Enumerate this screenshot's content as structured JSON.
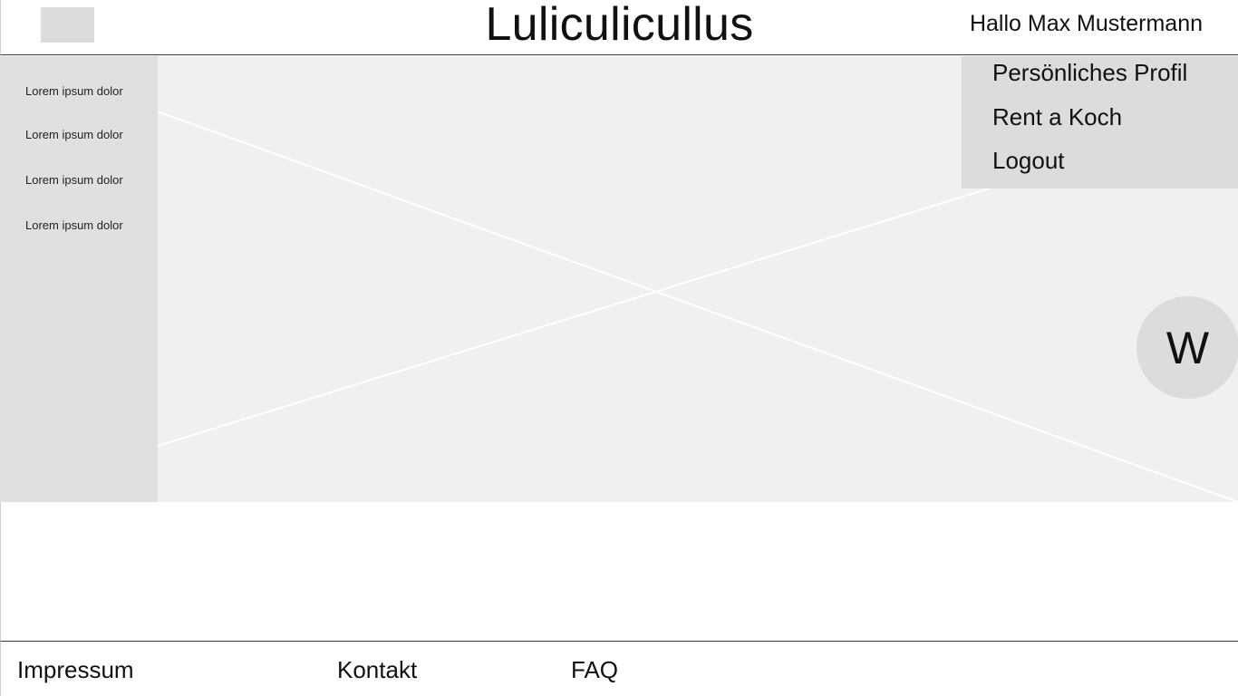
{
  "header": {
    "title": "Luliculicullus",
    "greeting": "Hallo Max Mustermann",
    "logo_icon": "logo-placeholder"
  },
  "sidebar": {
    "items": [
      {
        "label": "Lorem ipsum dolor"
      },
      {
        "label": "Lorem ipsum dolor"
      },
      {
        "label": "Lorem ipsum dolor"
      },
      {
        "label": "Lorem ipsum dolor"
      }
    ]
  },
  "hero": {
    "image_icon": "image-placeholder-icon"
  },
  "user_menu": {
    "items": [
      {
        "label": "Persönliches Profil"
      },
      {
        "label": "Rent a Koch"
      },
      {
        "label": "Logout"
      }
    ]
  },
  "fab": {
    "label": "W"
  },
  "footer": {
    "links": [
      {
        "label": "Impressum"
      },
      {
        "label": "Kontakt"
      },
      {
        "label": "FAQ"
      }
    ]
  },
  "colors": {
    "panel": "#e0e0e0",
    "hero_bg": "#f0f0f0",
    "menu_bg": "#dcdcdc",
    "divider": "#3a3a3a"
  }
}
